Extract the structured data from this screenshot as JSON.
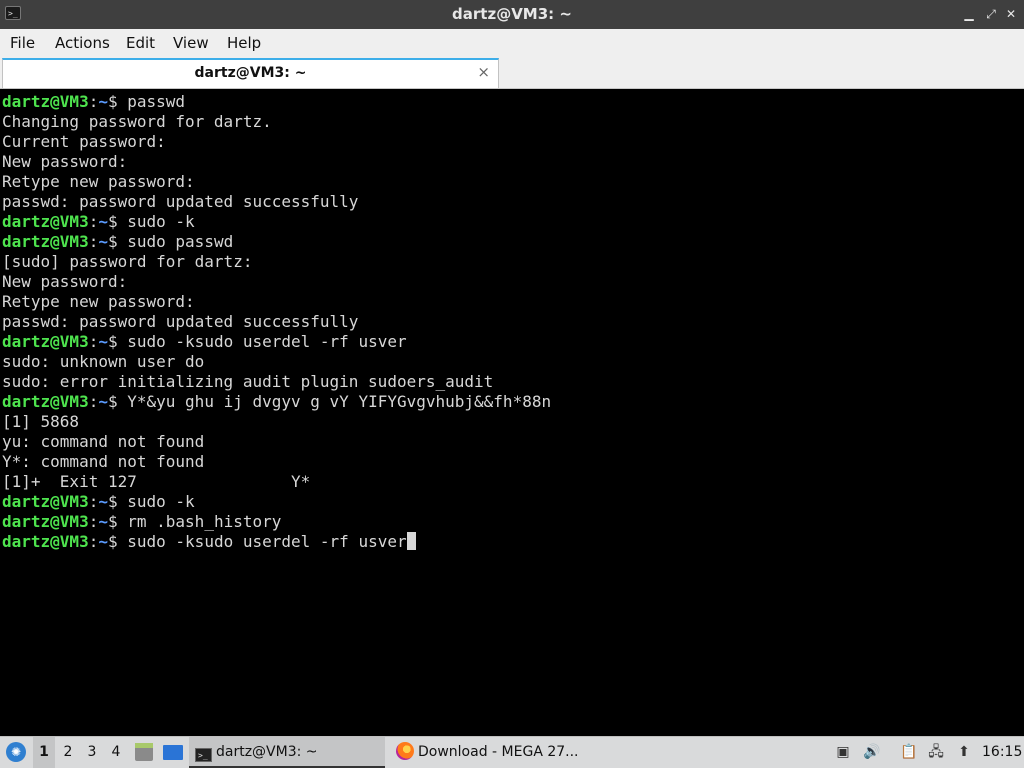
{
  "window": {
    "title": "dartz@VM3: ~",
    "app_icon": ">_",
    "controls": [
      "▁",
      "⤢",
      "✕"
    ]
  },
  "menu": [
    "File",
    "Actions",
    "Edit",
    "View",
    "Help"
  ],
  "tab": {
    "label": "dartz@VM3: ~",
    "close": "×"
  },
  "terminal": {
    "prompt": {
      "user": "dartz@VM3",
      "colon": ":",
      "path": "~",
      "symbol": "$ "
    },
    "lines": [
      {
        "prompt": true,
        "text": "passwd"
      },
      {
        "prompt": false,
        "text": "Changing password for dartz."
      },
      {
        "prompt": false,
        "text": "Current password:"
      },
      {
        "prompt": false,
        "text": "New password:"
      },
      {
        "prompt": false,
        "text": "Retype new password:"
      },
      {
        "prompt": false,
        "text": "passwd: password updated successfully"
      },
      {
        "prompt": true,
        "text": "sudo -k"
      },
      {
        "prompt": true,
        "text": "sudo passwd"
      },
      {
        "prompt": false,
        "text": "[sudo] password for dartz:"
      },
      {
        "prompt": false,
        "text": "New password:"
      },
      {
        "prompt": false,
        "text": "Retype new password:"
      },
      {
        "prompt": false,
        "text": "passwd: password updated successfully"
      },
      {
        "prompt": true,
        "text": "sudo -ksudo userdel -rf usver"
      },
      {
        "prompt": false,
        "text": "sudo: unknown user do"
      },
      {
        "prompt": false,
        "text": "sudo: error initializing audit plugin sudoers_audit"
      },
      {
        "prompt": true,
        "text": "Y*&yu ghu ij dvgyv g vY YIFYGvgvhubj&&fh*88n"
      },
      {
        "prompt": false,
        "text": "[1] 5868"
      },
      {
        "prompt": false,
        "text": "yu: command not found"
      },
      {
        "prompt": false,
        "text": "Y*: command not found"
      },
      {
        "prompt": false,
        "text": "[1]+  Exit 127                Y*"
      },
      {
        "prompt": true,
        "text": "sudo -k"
      },
      {
        "prompt": true,
        "text": "rm .bash_history"
      },
      {
        "prompt": true,
        "text": "sudo -ksudo userdel -rf usver",
        "cursor": true
      }
    ]
  },
  "taskbar": {
    "menu_icon": "lubuntu-icon",
    "workspaces": [
      "1",
      "2",
      "3",
      "4"
    ],
    "active_workspace": "1",
    "tasks": [
      {
        "label": "dartz@VM3: ~",
        "icon": "terminal-icon",
        "active": true
      },
      {
        "label": "Download - MEGA 27...",
        "icon": "firefox-icon",
        "active": false
      }
    ],
    "tray_icons": [
      "notification-icon",
      "volume-icon",
      "clipboard-icon",
      "network-icon"
    ],
    "clock": "16:15"
  }
}
